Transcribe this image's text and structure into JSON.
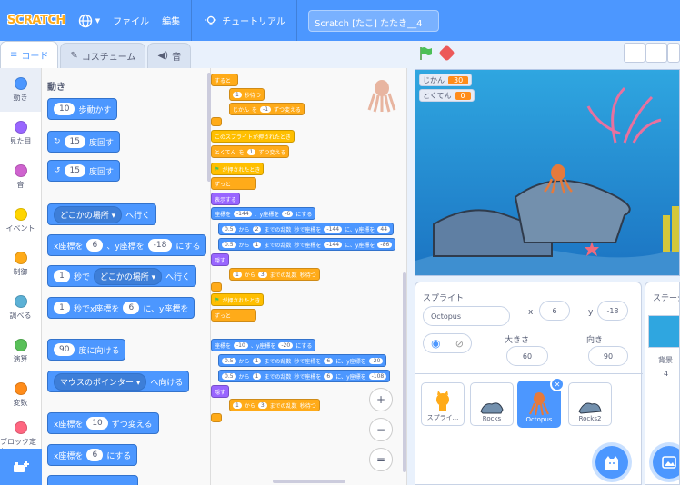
{
  "menubar": {
    "logo": "SCRATCH",
    "file": "ファイル",
    "edit": "編集",
    "tutorials": "チュートリアル",
    "project_title": "Scratch [たこ] たたき__4"
  },
  "tabs": {
    "code": "コード",
    "costumes": "コスチューム",
    "sounds": "音"
  },
  "categories": [
    {
      "label": "動き",
      "color": "#4c97ff"
    },
    {
      "label": "見た目",
      "color": "#9966ff"
    },
    {
      "label": "音",
      "color": "#cf63cf"
    },
    {
      "label": "イベント",
      "color": "#ffd500"
    },
    {
      "label": "制御",
      "color": "#ffab19"
    },
    {
      "label": "調べる",
      "color": "#5cb1d6"
    },
    {
      "label": "演算",
      "color": "#59c059"
    },
    {
      "label": "変数",
      "color": "#ff8c1a"
    },
    {
      "label": "ブロック定義",
      "color": "#ff6680"
    }
  ],
  "flyout": {
    "title": "動き",
    "move": {
      "value": "10",
      "text": "歩動かす"
    },
    "turn_right": {
      "value": "15",
      "text": "度回す"
    },
    "turn_left": {
      "value": "15",
      "text": "度回す"
    },
    "goto": {
      "drop": "どこかの場所",
      "text": "へ行く"
    },
    "gotoxy": {
      "x_label": "x座標を",
      "x": "6",
      "y_label": "、y座標を",
      "y": "-18",
      "text": "にする"
    },
    "glide_to": {
      "secs": "1",
      "mid": "秒で",
      "drop": "どこかの場所",
      "text": "へ行く"
    },
    "glide_xy": {
      "secs": "1",
      "text1": "秒でx座標を",
      "x": "6",
      "text2": "に、y座標を"
    },
    "point_dir": {
      "value": "90",
      "text": "度に向ける"
    },
    "point_towards": {
      "drop": "マウスのポインター",
      "text": "へ向ける"
    },
    "change_x": {
      "label": "x座標を",
      "value": "10",
      "text": "ずつ変える"
    },
    "set_x": {
      "label": "x座標を",
      "value": "6",
      "text": "にする"
    }
  },
  "script": {
    "b1": "すると",
    "b2": {
      "v": "1",
      "t": "秒待つ"
    },
    "b3": {
      "a": "じかん",
      "b": "を",
      "v": "-1",
      "t": "ずつ変える"
    },
    "b4": "このスプライトが押されたとき",
    "b5": {
      "a": "とくてん",
      "b": "を",
      "v": "1",
      "t": "ずつ変える"
    },
    "b6": "が押されたとき",
    "b7": "ずっと",
    "b8": "表示する",
    "b9": {
      "a": "座標を",
      "x": "-144",
      "b": "、y座標を",
      "y": "-6",
      "t": "にする"
    },
    "b10": {
      "s": "0.5",
      "a": "から",
      "v": "2",
      "b": "までの乱数",
      "c": "秒で座標を",
      "x": "-144",
      "d": "に、y座標を",
      "y": "44"
    },
    "b11": {
      "s": "0.5",
      "a": "から",
      "v": "1",
      "b": "までの乱数",
      "c": "秒で座標を",
      "x": "-144",
      "d": "に、y座標を",
      "y": "-86"
    },
    "b12": "隠す",
    "b13": {
      "v1": "1",
      "a": "から",
      "v2": "3",
      "b": "までの乱数",
      "t": "秒待つ"
    },
    "b14": "が押されたとき",
    "b15": "ずっと",
    "b16": {
      "a": "座標を",
      "x": "-10",
      "b": "、y座標を",
      "y": "-20",
      "t": "にする"
    },
    "b17": {
      "s": "0.5",
      "a": "から",
      "v": "1",
      "b": "までの乱数",
      "c": "秒で座標を",
      "x": "6",
      "d": "に、y座標を",
      "y": "-20"
    },
    "b18": {
      "s": "0.5",
      "a": "から",
      "v": "1",
      "b": "までの乱数",
      "c": "秒で座標を",
      "x": "6",
      "d": "に、y座標を",
      "y": "-108"
    },
    "b19": "隠す",
    "b20": {
      "v1": "1",
      "a": "から",
      "v2": "3",
      "b": "までの乱数",
      "t": "秒待つ"
    }
  },
  "zoom": {
    "in": "+",
    "out": "−",
    "reset": "="
  },
  "monitors": [
    {
      "label": "じかん",
      "value": "30"
    },
    {
      "label": "とくてん",
      "value": "0"
    }
  ],
  "sprite_panel": {
    "title": "スプライト",
    "name": "Octopus",
    "x_label": "x",
    "x": "6",
    "y_label": "y",
    "y": "-18",
    "size_label": "大きさ",
    "size": "60",
    "dir_label": "向き",
    "dir": "90"
  },
  "sprites": [
    "スプライ...",
    "Rocks",
    "Octopus",
    "Rocks2"
  ],
  "stage_panel": {
    "title": "ステージ",
    "bg_label": "背景",
    "bg_count": "4"
  }
}
